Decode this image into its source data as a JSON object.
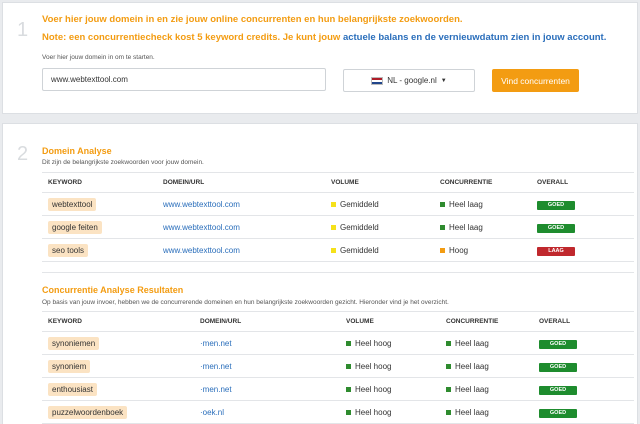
{
  "step1": {
    "number": "1",
    "intro_line1": "Voer hier jouw domein in en zie jouw online concurrenten en hun belangrijkste zoekwoorden.",
    "intro_line2_prefix": "Note: een concurrentiecheck kost 5 keyword credits. Je kunt jouw ",
    "intro_line2_link": "actuele balans en de vernieuwdatum zien in jouw account.",
    "hint": "Voer hier jouw domein in om te starten.",
    "domain_value": "www.webtexttool.com",
    "country_label": "NL - google.nl",
    "find_button": "Vind concurrenten"
  },
  "step2": {
    "number": "2",
    "domain_analysis": {
      "title": "Domein Analyse",
      "subtitle": "Dit zijn de belangrijkste zoekwoorden voor jouw domein.",
      "headers": [
        "KEYWORD",
        "DOMEIN/URL",
        "VOLUME",
        "CONCURRENTIE",
        "OVERALL"
      ],
      "rows": [
        {
          "keyword": "webtexttool",
          "domain": "www.webtexttool.com",
          "volume": "Gemiddeld",
          "volume_color": "#f5e11a",
          "competition": "Heel laag",
          "competition_color": "#2e8b2e",
          "overall": "GOED",
          "overall_color": "#1e8c2e"
        },
        {
          "keyword": "google feiten",
          "domain": "www.webtexttool.com",
          "volume": "Gemiddeld",
          "volume_color": "#f5e11a",
          "competition": "Heel laag",
          "competition_color": "#2e8b2e",
          "overall": "GOED",
          "overall_color": "#1e8c2e"
        },
        {
          "keyword": "seo tools",
          "domain": "www.webtexttool.com",
          "volume": "Gemiddeld",
          "volume_color": "#f5e11a",
          "competition": "Hoog",
          "competition_color": "#f39c12",
          "overall": "LAAG",
          "overall_color": "#c0282d"
        }
      ]
    },
    "competitor_analysis": {
      "title": "Concurrentie Analyse Resultaten",
      "subtitle": "Op basis van jouw invoer, hebben we de concurrerende domeinen en hun belangrijkste zoekwoorden gezicht. Hieronder vind je het overzicht.",
      "headers": [
        "KEYWORD",
        "DOMEIN/URL",
        "VOLUME",
        "CONCURRENTIE",
        "OVERALL"
      ],
      "rows": [
        {
          "keyword": "synoniemen",
          "domain": "·men.net",
          "volume": "Heel hoog",
          "volume_color": "#2e8b2e",
          "competition": "Heel laag",
          "competition_color": "#2e8b2e",
          "overall": "GOED",
          "overall_color": "#1e8c2e"
        },
        {
          "keyword": "synoniem",
          "domain": "·men.net",
          "volume": "Heel hoog",
          "volume_color": "#2e8b2e",
          "competition": "Heel laag",
          "competition_color": "#2e8b2e",
          "overall": "GOED",
          "overall_color": "#1e8c2e"
        },
        {
          "keyword": "enthousiast",
          "domain": "·men.net",
          "volume": "Heel hoog",
          "volume_color": "#2e8b2e",
          "competition": "Heel laag",
          "competition_color": "#2e8b2e",
          "overall": "GOED",
          "overall_color": "#1e8c2e"
        },
        {
          "keyword": "puzzelwoordenboek",
          "domain": "·oek.nl",
          "volume": "Heel hoog",
          "volume_color": "#2e8b2e",
          "competition": "Heel laag",
          "competition_color": "#2e8b2e",
          "overall": "GOED",
          "overall_color": "#1e8c2e"
        }
      ]
    }
  },
  "colors": {
    "accent": "#f39c12",
    "link": "#2a6ebb",
    "good": "#1e8c2e",
    "bad": "#c0282d"
  }
}
